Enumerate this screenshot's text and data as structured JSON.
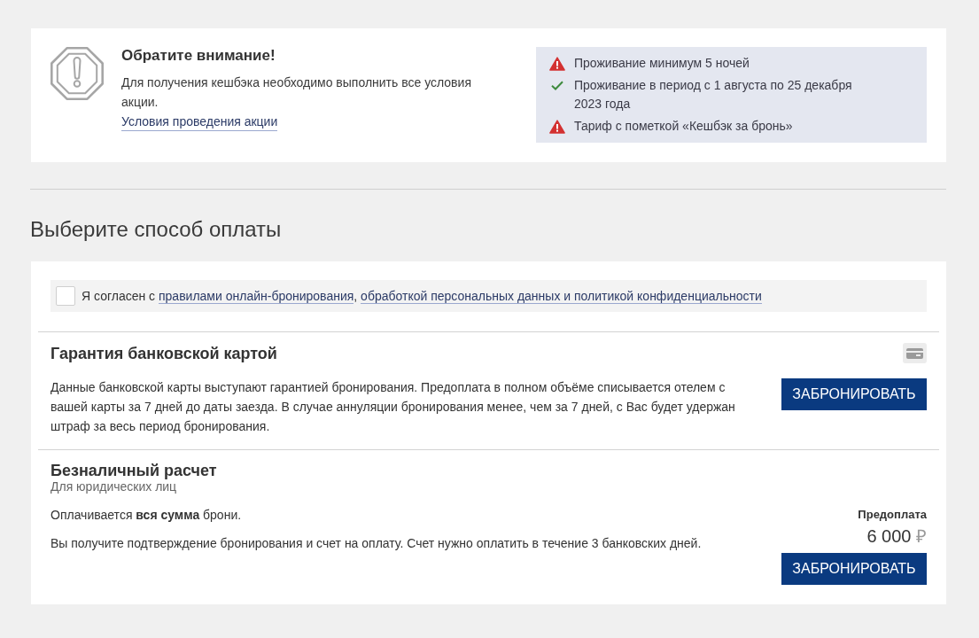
{
  "notice": {
    "title": "Обратите внимание!",
    "text": "Для получения кешбэка необходимо выполнить все условия акции.",
    "link": "Условия проведения акции",
    "conditions": [
      {
        "text": "Проживание минимум 5 ночей",
        "met": false
      },
      {
        "text": "Проживание в период с 1 августа по 25 декабря 2023 года",
        "met": true
      },
      {
        "text": "Тариф с пометкой «Кешбэк за бронь»",
        "met": false
      }
    ]
  },
  "payment": {
    "heading": "Выберите способ оплаты",
    "agreement": {
      "checked": false,
      "parts": [
        {
          "kind": "text",
          "text": "Я согласен с "
        },
        {
          "kind": "link",
          "text": "правилами онлайн-бронирования"
        },
        {
          "kind": "text",
          "text": ", "
        },
        {
          "kind": "link",
          "text": "обработкой персональных данных и политикой конфиденциальности"
        }
      ]
    },
    "methods": [
      {
        "kind": "card",
        "title": "Гарантия банковской картой",
        "description": "Данные банковской карты выступают гарантией бронирования. Предоплата в полном объёме списывается отелем с вашей карты за 7 дней до даты заезда. В случае аннуляции бронирования менее, чем за 7 дней, с Вас будет удержан штраф за весь период бронирования.",
        "button": "ЗАБРОНИРОВАТЬ"
      },
      {
        "kind": "invoice",
        "title": "Безналичный расчет",
        "subtitle": "Для юридических лиц",
        "paragraphs": [
          "Оплачивается **вся сумма** брони.",
          "Вы получите подтверждение бронирования и счет на оплату. Счет нужно оплатить в течение 3 банковских дней."
        ],
        "prepayment_label": "Предоплата",
        "amount": "6 000",
        "currency": "₽",
        "button": "ЗАБРОНИРОВАТЬ"
      }
    ]
  }
}
